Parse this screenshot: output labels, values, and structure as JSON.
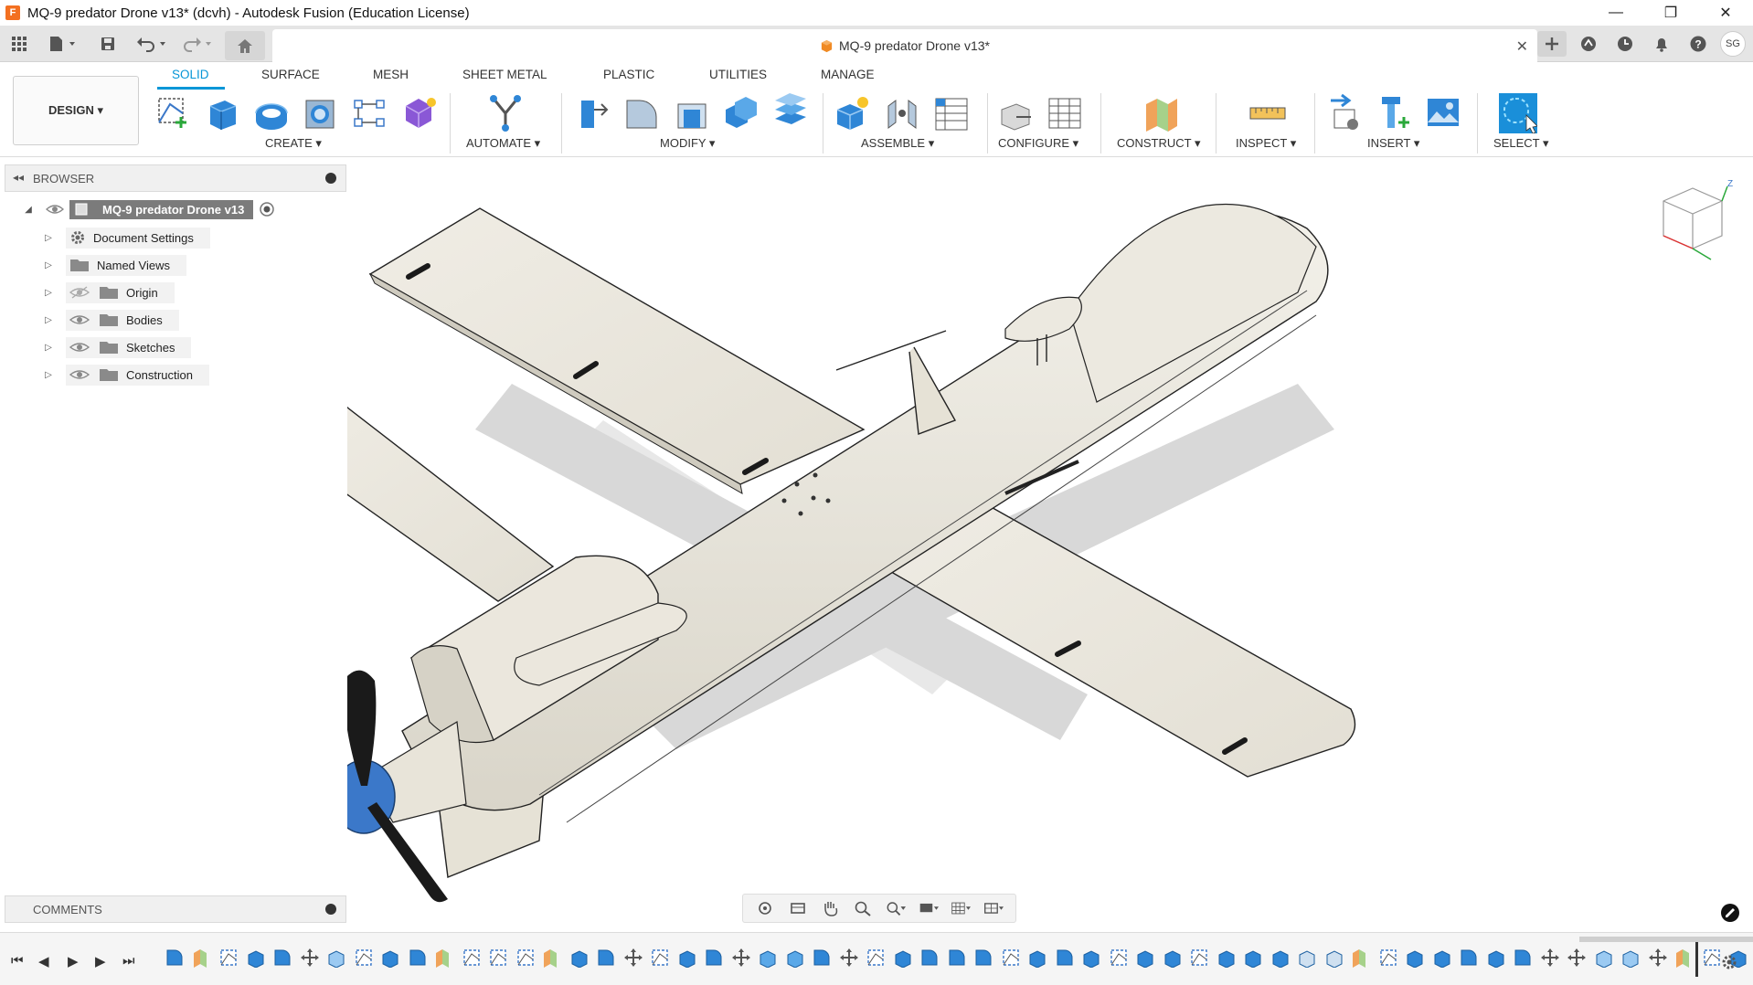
{
  "window": {
    "title": "MQ-9 predator Drone v13* (dcvh) - Autodesk Fusion (Education License)",
    "logo": "F",
    "minimize": "—",
    "restore": "❐",
    "close": "✕"
  },
  "doc_tab": {
    "title": "MQ-9 predator Drone v13*",
    "close": "✕"
  },
  "user": {
    "initials": "SG"
  },
  "workspace": {
    "label": "DESIGN ▾"
  },
  "tabs": [
    "SOLID",
    "SURFACE",
    "MESH",
    "SHEET METAL",
    "PLASTIC",
    "UTILITIES",
    "MANAGE"
  ],
  "groups": [
    "CREATE ▾",
    "AUTOMATE ▾",
    "MODIFY ▾",
    "ASSEMBLE ▾",
    "CONFIGURE ▾",
    "CONSTRUCT ▾",
    "INSPECT ▾",
    "INSERT ▾",
    "SELECT ▾"
  ],
  "browser": {
    "title": "BROWSER",
    "root": "MQ-9 predator Drone v13",
    "items": [
      "Document Settings",
      "Named Views",
      "Origin",
      "Bodies",
      "Sketches",
      "Construction"
    ]
  },
  "comments": {
    "title": "COMMENTS"
  },
  "colors": {
    "accent": "#0696d7",
    "model": "#ebe8df",
    "prop": "#1a1a1a",
    "spinner": "#3b78c9"
  }
}
